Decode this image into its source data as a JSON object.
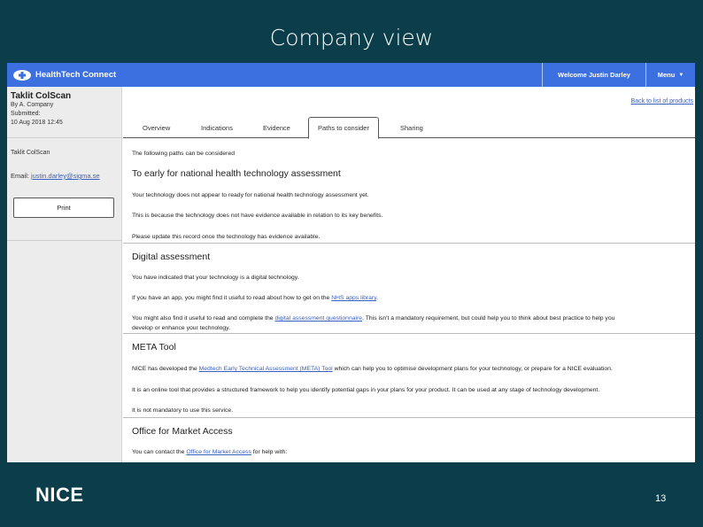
{
  "slide": {
    "title": "Company view",
    "page_number": "13",
    "logo_text": "NICE"
  },
  "app": {
    "brand": "HealthTech Connect",
    "welcome": "Welcome Justin Darley",
    "menu": "Menu"
  },
  "sidebar": {
    "product_name": "Taklit ColScan",
    "by_line": "By A. Company",
    "submitted_label": "Submitted:",
    "submitted_date": "10 Aug 2018 12:45",
    "product_name_2": "Taklit ColScan",
    "email_label": "Email:",
    "email": "justin.darley@sigma.se",
    "print_label": "Print"
  },
  "main": {
    "back_link": "Back to list of products",
    "tabs": [
      "Overview",
      "Indications",
      "Evidence",
      "Paths to consider",
      "Sharing"
    ],
    "active_tab": "Paths to consider",
    "intro": "The following paths can be considered",
    "sections": {
      "early": {
        "heading": "To early for national health technology assessment",
        "p1": "Your technology does not appear to ready for national health technology assessment yet.",
        "p2": "This is because the technology does not have evidence available in relation to its key benefits.",
        "p3": "Please update this record once the technology has evidence available."
      },
      "digital": {
        "heading": "Digital assessment",
        "p1": "You have indicated that your technology is a digital technology.",
        "p2_pre": "If you have an app, you might find it useful to read about how to get on the ",
        "p2_link": "NHS apps library",
        "p2_post": ".",
        "p3_pre": "You might also find it useful to read and complete the ",
        "p3_link": "digital assessment questionnaire",
        "p3_post": ". This isn't a mandatory requirement, but could help you to think about best practice to help you",
        "p3_line2": "develop or enhance your technology."
      },
      "meta": {
        "heading": "META Tool",
        "p1_pre": "NICE has developed the ",
        "p1_link": "Medtech Early Technical Assessment (META) Tool",
        "p1_post": " which can help you to optimise development plans for your technology, or prepare for a NICE evaluation.",
        "p2": "It is an online tool that provides a structured framework to help you identify potential gaps in your plans for your product. It can be used at any stage of technology development.",
        "p3": "It is not mandatory to use this service."
      },
      "oma": {
        "heading": "Office for Market Access",
        "p1_pre": "You can contact the ",
        "p1_link": "Office for Market Access",
        "p1_post": " for help with:"
      }
    }
  }
}
